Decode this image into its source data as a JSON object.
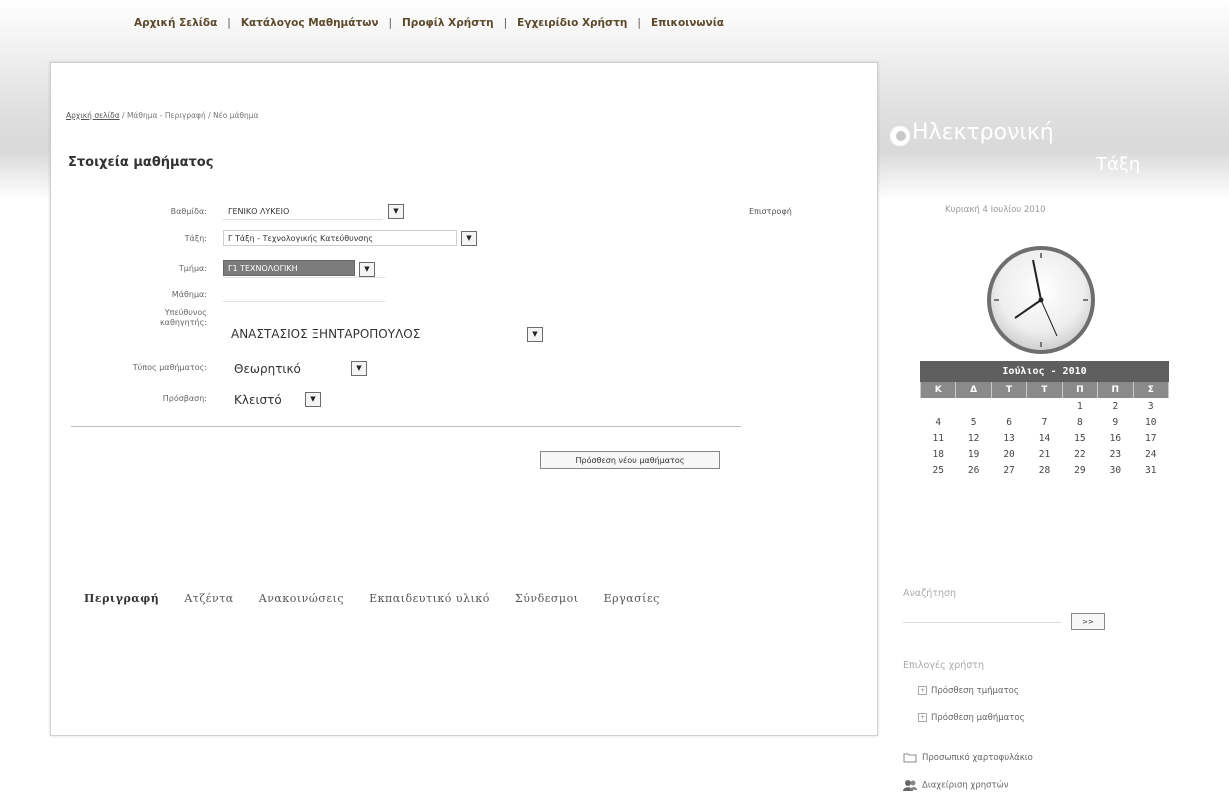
{
  "topnav": [
    "Αρχική Σελίδα",
    "Κατάλογος Μαθημάτων",
    "Προφίλ Χρήστη",
    "Εγχειρίδιο Χρήστη",
    "Επικοινωνία"
  ],
  "breadcrumb": {
    "home": "Αρχική σελίδα",
    "sep1": "/",
    "section": "Μάθημα - Περιγραφή",
    "sep2": "/",
    "current": "Νέο μάθημα"
  },
  "page_title": "Στοιχεία μαθήματος",
  "back_link": "Επιστροφή",
  "form": {
    "vathmida_label": "Βαθμίδα:",
    "vathmida_value": "ΓΕΝΙΚΟ ΛΥΚΕΙΟ",
    "taxi_label": "Τάξη:",
    "taxi_value": "Γ Τάξη - Τεχνολογικής Κατεύθυνσης",
    "tmima_label": "Τμήμα:",
    "tmima_value": "Γ1 ΤΕΧΝΟΛΟΓΙΚΗ",
    "mathima_label": "Μάθημα:",
    "ypeuthynos_label": "Υπεύθυνος καθηγητής:",
    "ypeuthynos_value": "ΑΝΑΣΤΑΣΙΟΣ ΞΗΝΤΑΡΟΠΟΥΛΟΣ",
    "typos_label": "Τύπος μαθήματος:",
    "typos_value": "Θεωρητικό",
    "prosvasi_label": "Πρόσβαση:",
    "prosvasi_value": "Κλειστό"
  },
  "add_button": "Πρόσθεση νέου μαθήματος",
  "tabs": [
    "Περιγραφή",
    "Ατζέντα",
    "Ανακοινώσεις",
    "Εκπαιδευτικό υλικό",
    "Σύνδεσμοι",
    "Εργασίες"
  ],
  "logo": {
    "line1": "Ηλεκτρονική",
    "line2": "Τάξη"
  },
  "date_text": "Κυριακή 4 Ιουλίου 2010",
  "calendar": {
    "title": "Ιούλιος - 2010",
    "days": [
      "Κ",
      "Δ",
      "Τ",
      "Τ",
      "Π",
      "Π",
      "Σ"
    ],
    "weeks": [
      [
        "",
        "",
        "",
        "",
        "1",
        "2",
        "3"
      ],
      [
        "4",
        "5",
        "6",
        "7",
        "8",
        "9",
        "10"
      ],
      [
        "11",
        "12",
        "13",
        "14",
        "15",
        "16",
        "17"
      ],
      [
        "18",
        "19",
        "20",
        "21",
        "22",
        "23",
        "24"
      ],
      [
        "25",
        "26",
        "27",
        "28",
        "29",
        "30",
        "31"
      ]
    ]
  },
  "search": {
    "label": "Αναζήτηση",
    "button": ">>"
  },
  "user_options": {
    "title": "Επιλογές χρήστη",
    "add_class": "Πρόσθεση τμήματος",
    "add_course": "Πρόσθεση μαθήματος",
    "portfolio": "Προσωπικό χαρτοφυλάκιο",
    "manage_users": "Διαχείριση χρηστών"
  },
  "colors": {
    "topnav_text": "#5d4a2c",
    "calendar_header": "#5f5f5f",
    "calendar_days": "#8a8a8a",
    "selected_field": "#7c7c7c"
  },
  "icons": [
    "clock-icon",
    "dropdown-arrow-icon",
    "plus-box-icon",
    "folder-icon",
    "users-icon",
    "logo-icon"
  ]
}
